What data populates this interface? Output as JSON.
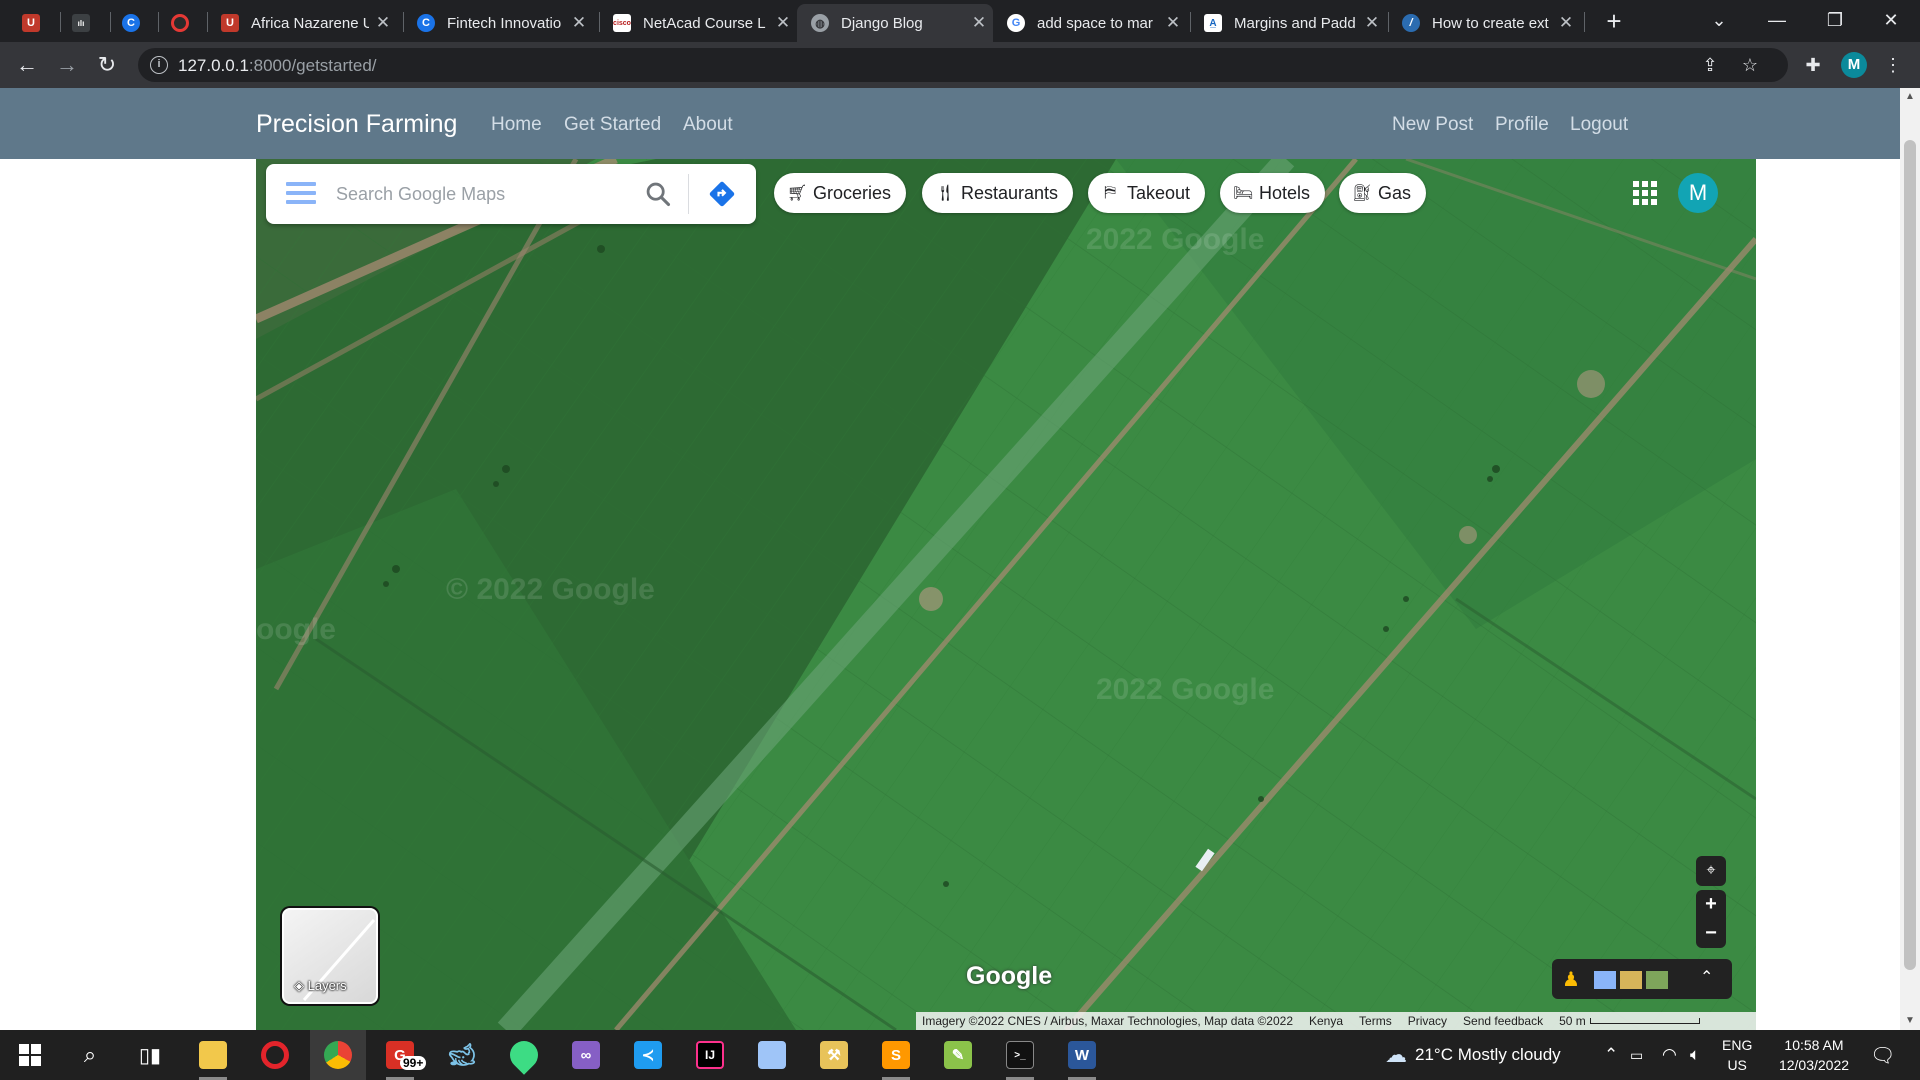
{
  "tabs": [
    {
      "title": "",
      "icon": "shield-favicon-icon",
      "color": "#c0392b",
      "pinned": true
    },
    {
      "title": "",
      "icon": "cisco-favicon-icon",
      "color": "#3c4043",
      "pinned": true
    },
    {
      "title": "",
      "icon": "c-favicon-icon",
      "color": "#1a73e8",
      "pinned": true
    },
    {
      "title": "",
      "icon": "record-favicon-icon",
      "color": "#e53935",
      "pinned": true
    },
    {
      "title": "Africa Nazarene U",
      "icon": "shield-favicon-icon",
      "color": "#c0392b"
    },
    {
      "title": "Fintech Innovatio",
      "icon": "c-favicon-icon",
      "color": "#1a73e8"
    },
    {
      "title": "NetAcad Course L",
      "icon": "cisco-favicon-icon",
      "color": "#b71c1c"
    },
    {
      "title": "Django Blog",
      "icon": "globe-favicon-icon",
      "color": "#5f6368",
      "active": true
    },
    {
      "title": "add space to mar",
      "icon": "google-favicon-icon",
      "color": "#ffffff"
    },
    {
      "title": "Margins and Padd",
      "icon": "w3-favicon-icon",
      "color": "#1565c0"
    },
    {
      "title": "How to create ext",
      "icon": "edge-favicon-icon",
      "color": "#2b6cb0"
    }
  ],
  "address": {
    "host": "127.0.0.1",
    "rest": ":8000/getstarted/"
  },
  "profile_initial": "M",
  "site": {
    "brand": "Precision Farming",
    "nav_left": [
      "Home",
      "Get Started",
      "About"
    ],
    "nav_right": [
      "New Post",
      "Profile",
      "Logout"
    ]
  },
  "map": {
    "search_placeholder": "Search Google Maps",
    "chips": [
      {
        "label": "Groceries",
        "icon": "cart-icon"
      },
      {
        "label": "Restaurants",
        "icon": "fork-knife-icon"
      },
      {
        "label": "Takeout",
        "icon": "takeout-bag-icon"
      },
      {
        "label": "Hotels",
        "icon": "bed-icon"
      },
      {
        "label": "Gas",
        "icon": "fuel-pump-icon"
      }
    ],
    "avatar": "M",
    "layers_label": "Layers",
    "watermark": "Google",
    "attribution": "Imagery ©2022 CNES / Airbus, Maxar Technologies, Map data ©2022",
    "footer_links": [
      "Kenya",
      "Terms",
      "Privacy",
      "Send feedback"
    ],
    "scale": "50 m"
  },
  "taskbar": {
    "notification_badge": "99+",
    "weather": "21°C  Mostly cloudy",
    "lang_top": "ENG",
    "lang_bottom": "US",
    "time": "10:58 AM",
    "date": "12/03/2022"
  },
  "colors": {
    "navbar": "#5f788a",
    "chrome_dark": "#202124",
    "field_dark": "#2f6b33",
    "field_light": "#3f9146"
  }
}
